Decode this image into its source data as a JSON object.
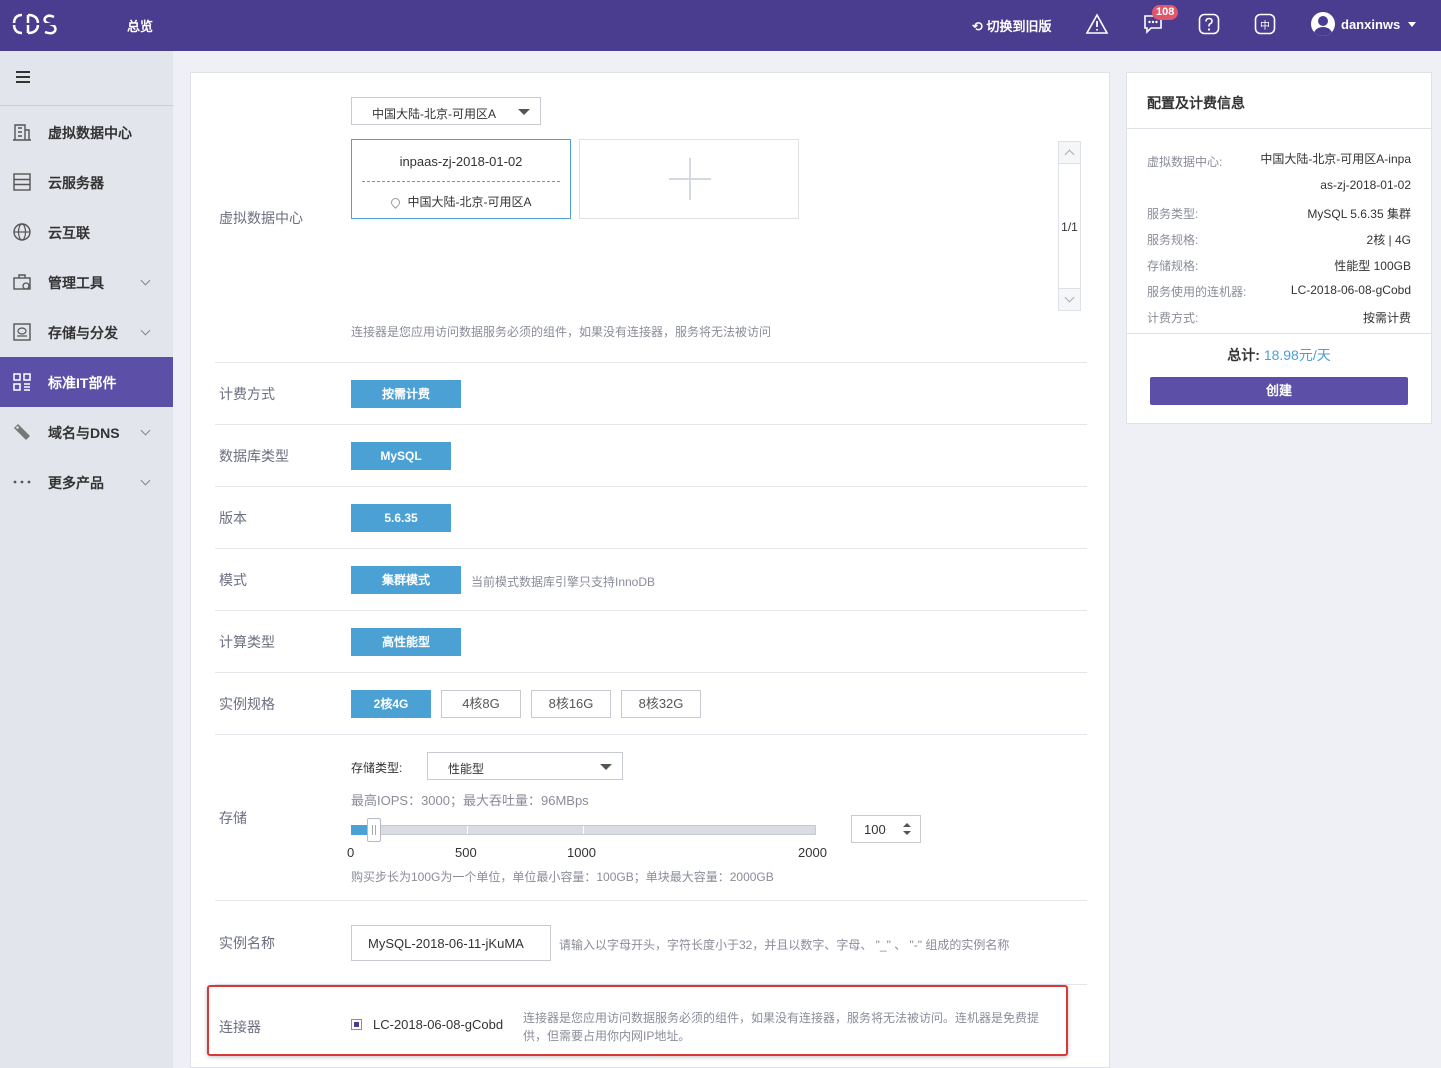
{
  "topbar": {
    "logo_text": "CDS",
    "overview": "总览",
    "switch_old": "切换到旧版",
    "message_count": "108",
    "lang": "中",
    "username": "danxinws"
  },
  "sidebar": {
    "items": [
      {
        "label": "虚拟数据中心",
        "icon": "building-icon"
      },
      {
        "label": "云服务器",
        "icon": "server-icon"
      },
      {
        "label": "云互联",
        "icon": "globe-icon"
      },
      {
        "label": "管理工具",
        "icon": "tools-icon",
        "expandable": true
      },
      {
        "label": "存储与分发",
        "icon": "storage-icon",
        "expandable": true
      },
      {
        "label": "标准IT部件",
        "icon": "grid-icon",
        "active": true
      },
      {
        "label": "域名与DNS",
        "icon": "tag-icon",
        "expandable": true
      },
      {
        "label": "更多产品",
        "icon": "more-icon",
        "expandable": true
      }
    ]
  },
  "form": {
    "vdc": {
      "label": "虚拟数据中心",
      "region": "中国大陆-北京-可用区A",
      "card_name": "inpaas-zj-2018-01-02",
      "card_location": "中国大陆-北京-可用区A",
      "page": "1/1",
      "hint": "连接器是您应用访问数据服务必须的组件，如果没有连接器，服务将无法被访问"
    },
    "billing": {
      "label": "计费方式",
      "option": "按需计费"
    },
    "db_type": {
      "label": "数据库类型",
      "option": "MySQL"
    },
    "version": {
      "label": "版本",
      "option": "5.6.35"
    },
    "mode": {
      "label": "模式",
      "option": "集群模式",
      "hint": "当前模式数据库引擎只支持InnoDB"
    },
    "compute": {
      "label": "计算类型",
      "option": "高性能型"
    },
    "spec": {
      "label": "实例规格",
      "options": [
        "2核4G",
        "4核8G",
        "8核16G",
        "8核32G"
      ],
      "selected": 0
    },
    "storage": {
      "label": "存储",
      "type_label": "存储类型:",
      "type_value": "性能型",
      "iops_info": "最高IOPS：3000；最大吞吐量：96MBps",
      "scale": [
        "0",
        "500",
        "1000",
        "2000"
      ],
      "value": 100,
      "max": 2000,
      "value_text": "100",
      "note": "购买步长为100G为一个单位，单位最小容量：100GB；单块最大容量：2000GB"
    },
    "instance_name": {
      "label": "实例名称",
      "value": "MySQL-2018-06-11-jKuMA",
      "hint": "请输入以字母开头，字符长度小于32，并且以数字、字母、 \"_\" 、 \"-\" 组成的实例名称"
    },
    "connector": {
      "label": "连接器",
      "value": "LC-2018-06-08-gCobd",
      "checked": true,
      "desc": "连接器是您应用访问数据服务必须的组件，如果没有连接器，服务将无法被访问。连机器是免费提供，但需要占用你内网IP地址。"
    }
  },
  "summary": {
    "title": "配置及计费信息",
    "vdc_key": "虚拟数据中心:",
    "vdc_value": "中国大陆-北京-可用区A-inpaas-zj-2018-01-02",
    "rows": [
      {
        "k": "服务类型:",
        "v": "MySQL 5.6.35 集群"
      },
      {
        "k": "服务规格:",
        "v": "2核 | 4G"
      },
      {
        "k": "存储规格:",
        "v": "性能型 100GB"
      },
      {
        "k": "服务使用的连机器:",
        "v": "LC-2018-06-08-gCobd"
      },
      {
        "k": "计费方式:",
        "v": "按需计费"
      }
    ],
    "total_label": "总计:",
    "total_value": "18.98元/天",
    "create": "创建"
  },
  "colors": {
    "topbar": "#4a3d8f",
    "accent": "#4ba1d4",
    "primary": "#5c4fa8",
    "highlight": "#d9383a"
  }
}
